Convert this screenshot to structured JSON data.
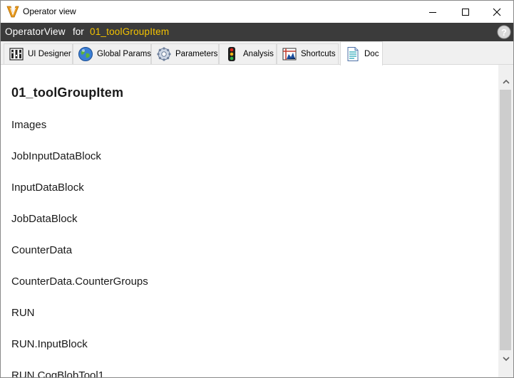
{
  "window": {
    "title": "Operator view",
    "controls": {
      "minimize": "minimize-icon",
      "maximize": "maximize-icon",
      "close": "close-icon"
    }
  },
  "header": {
    "label": "OperatorView",
    "for_text": "for",
    "value": "01_toolGroupItem",
    "value_color": "#f5c400",
    "background": "#3b3b3b",
    "help_icon": "help-icon"
  },
  "tabs": [
    {
      "label": "UI Designer",
      "icon": "ui-designer-icon"
    },
    {
      "label": "Global Params",
      "icon": "globe-icon"
    },
    {
      "label": "Parameters",
      "icon": "gear-icon"
    },
    {
      "label": "Analysis",
      "icon": "traffic-light-icon"
    },
    {
      "label": "Shortcuts",
      "icon": "shortcuts-icon"
    },
    {
      "label": "Doc",
      "icon": "document-icon",
      "active": true
    }
  ],
  "doc": {
    "title": "01_toolGroupItem",
    "items": [
      "Images",
      "JobInputDataBlock",
      "InputDataBlock",
      "JobDataBlock",
      "CounterData",
      "CounterData.CounterGroups",
      "RUN",
      "RUN.InputBlock",
      "RUN.CogBlobTool1"
    ]
  }
}
